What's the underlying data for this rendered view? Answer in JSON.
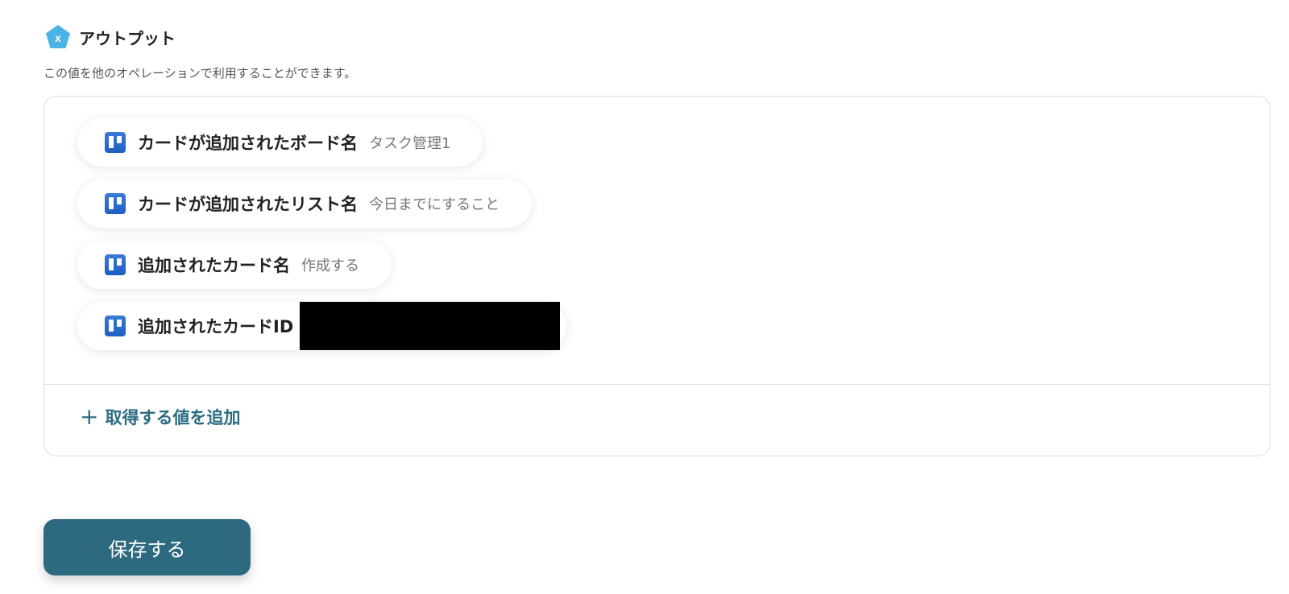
{
  "section": {
    "title": "アウトプット",
    "icon": "yoom-pentagon-x-icon",
    "icon_letter": "x",
    "description": "この値を他のオペレーションで利用することができます。"
  },
  "outputs": [
    {
      "icon": "trello-icon",
      "label": "カードが追加されたボード名",
      "value": "タスク管理1"
    },
    {
      "icon": "trello-icon",
      "label": "カードが追加されたリスト名",
      "value": "今日までにすること"
    },
    {
      "icon": "trello-icon",
      "label": "追加されたカード名",
      "value": "作成する"
    },
    {
      "icon": "trello-icon",
      "label": "追加されたカードID",
      "value": "",
      "redacted": true
    }
  ],
  "add_value": {
    "icon": "plus-icon",
    "label": "取得する値を追加"
  },
  "save_button": {
    "label": "保存する"
  },
  "colors": {
    "accent": "#2d6a80",
    "icon_blue": "#4bb3e6",
    "trello_blue": "#1f5fc6",
    "muted_text": "#777777"
  }
}
